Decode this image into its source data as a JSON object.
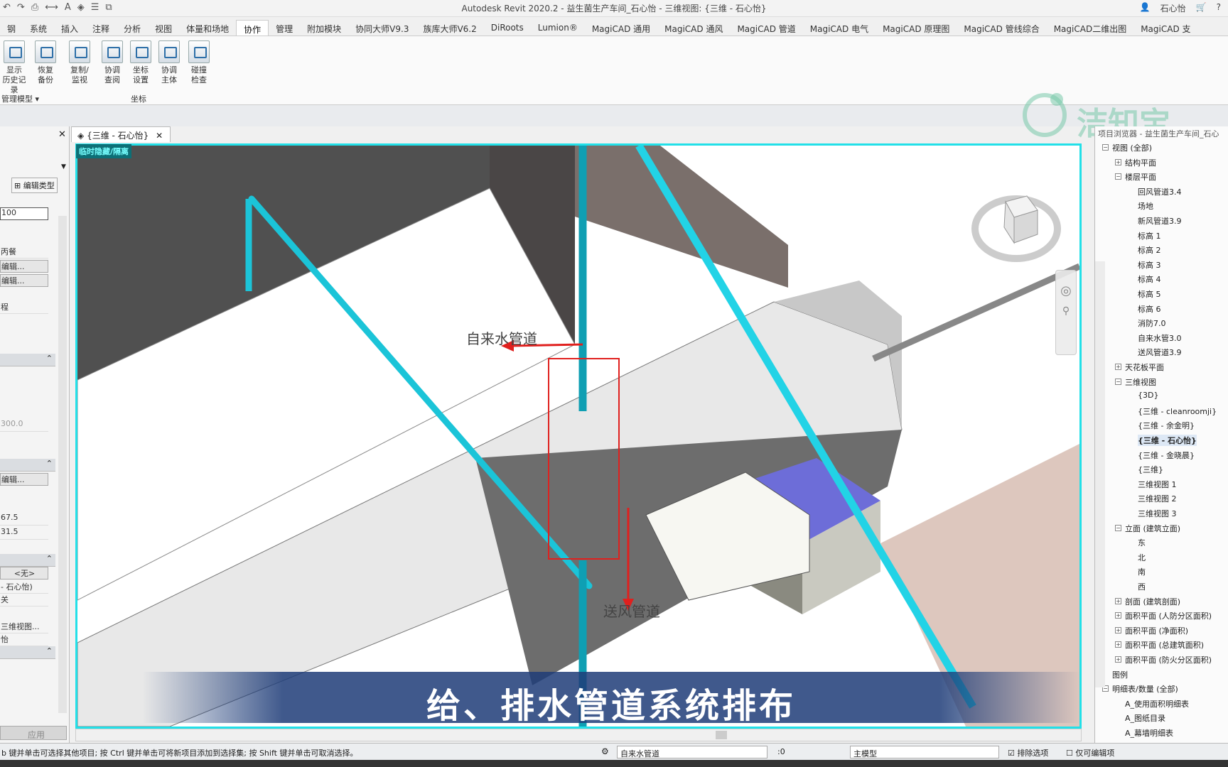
{
  "titlebar": {
    "title": "Autodesk Revit 2020.2 - 益生菌生产车间_石心怡 - 三维视图: {三维 - 石心怡}",
    "user": "石心怡"
  },
  "ribbon_tabs": [
    "钢",
    "系统",
    "插入",
    "注释",
    "分析",
    "视图",
    "体量和场地",
    "协作",
    "管理",
    "附加模块",
    "协同大师V9.3",
    "族库大师V6.2",
    "DiRoots",
    "Lumion®",
    "MagiCAD 通用",
    "MagiCAD 通风",
    "MagiCAD 管道",
    "MagiCAD 电气",
    "MagiCAD 原理图",
    "MagiCAD 管线综合",
    "MagiCAD二维出图",
    "MagiCAD 支"
  ],
  "ribbon_buttons": [
    {
      "l1": "显示",
      "l2": "历史记录"
    },
    {
      "l1": "恢复",
      "l2": "备份"
    },
    {
      "l1": "复制/",
      "l2": "监视"
    },
    {
      "l1": "协调",
      "l2": "查阅"
    },
    {
      "l1": "坐标",
      "l2": "设置"
    },
    {
      "l1": "协调",
      "l2": "主体"
    },
    {
      "l1": "碰撞",
      "l2": "检查"
    }
  ],
  "ribbon_groups": {
    "manage_model": "管理模型 ▾",
    "coords": "坐标"
  },
  "left_panel": {
    "edit_type": "编辑类型",
    "rows": [
      "100",
      "丙餐",
      "编辑...",
      "编辑...",
      "程",
      "300.0",
      "编辑...",
      "67.5",
      "31.5",
      "<无>",
      "- 石心怡)",
      "关",
      "三维视图...",
      "怡"
    ],
    "apply": "应用"
  },
  "view_tab": "{三维 - 石心怡}",
  "view_badge": "临时隐藏/隔离",
  "annotations": {
    "water_pipe": "自来水管道",
    "drain_pipe": "送风管道"
  },
  "subtitle": "给、排水管道系统排布",
  "watermark": "洁知宝",
  "project_browser": {
    "header": "项目浏览器 - 益生菌生产车间_石心",
    "items": [
      {
        "label": "视图 (全部)",
        "level": 0,
        "tog": "⊟"
      },
      {
        "label": "结构平面",
        "level": 1,
        "tog": "⊞"
      },
      {
        "label": "楼层平面",
        "level": 1,
        "tog": "⊟"
      },
      {
        "label": "回风管道3.4",
        "level": 2
      },
      {
        "label": "场地",
        "level": 2
      },
      {
        "label": "新风管道3.9",
        "level": 2
      },
      {
        "label": "标高 1",
        "level": 2
      },
      {
        "label": "标高 2",
        "level": 2
      },
      {
        "label": "标高 3",
        "level": 2
      },
      {
        "label": "标高 4",
        "level": 2
      },
      {
        "label": "标高 5",
        "level": 2
      },
      {
        "label": "标高 6",
        "level": 2
      },
      {
        "label": "消防7.0",
        "level": 2
      },
      {
        "label": "自来水管3.0",
        "level": 2
      },
      {
        "label": "送风管道3.9",
        "level": 2
      },
      {
        "label": "天花板平面",
        "level": 1,
        "tog": "⊞"
      },
      {
        "label": "三维视图",
        "level": 1,
        "tog": "⊟"
      },
      {
        "label": "{3D}",
        "level": 2
      },
      {
        "label": "{三维 - cleanroomji}",
        "level": 2
      },
      {
        "label": "{三维 - 余金明}",
        "level": 2
      },
      {
        "label": "{三维 - 石心怡}",
        "level": 2,
        "selected": true
      },
      {
        "label": "{三维 - 金晓晨}",
        "level": 2
      },
      {
        "label": "{三维}",
        "level": 2
      },
      {
        "label": "三维视图 1",
        "level": 2
      },
      {
        "label": "三维视图 2",
        "level": 2
      },
      {
        "label": "三维视图 3",
        "level": 2
      },
      {
        "label": "立面 (建筑立面)",
        "level": 1,
        "tog": "⊟"
      },
      {
        "label": "东",
        "level": 2
      },
      {
        "label": "北",
        "level": 2
      },
      {
        "label": "南",
        "level": 2
      },
      {
        "label": "西",
        "level": 2
      },
      {
        "label": "剖面 (建筑剖面)",
        "level": 1,
        "tog": "⊞"
      },
      {
        "label": "面积平面 (人防分区面积)",
        "level": 1,
        "tog": "⊞"
      },
      {
        "label": "面积平面 (净面积)",
        "level": 1,
        "tog": "⊞"
      },
      {
        "label": "面积平面 (总建筑面积)",
        "level": 1,
        "tog": "⊞"
      },
      {
        "label": "面积平面 (防火分区面积)",
        "level": 1,
        "tog": "⊞"
      },
      {
        "label": "图例",
        "level": 0
      },
      {
        "label": "明细表/数量 (全部)",
        "level": 0,
        "tog": "⊟"
      },
      {
        "label": "A_使用面积明细表",
        "level": 1
      },
      {
        "label": "A_图纸目录",
        "level": 1
      },
      {
        "label": "A_幕墙明细表",
        "level": 1
      }
    ]
  },
  "statusbar": {
    "message": "b 键并单击可选择其他项目; 按 Ctrl 键并单击可将新项目添加到选择集; 按 Shift 键并单击可取消选择。",
    "system": "自来水管道",
    "count": ":0",
    "model": "主模型",
    "exclude": "排除选项",
    "editable_only": "仅可编辑项"
  },
  "colors": {
    "pipe": "#22d3e6",
    "viewport_border": "#22e0e8",
    "annotation": "#e0201e",
    "subtitle_bg": "#1e3c78"
  }
}
